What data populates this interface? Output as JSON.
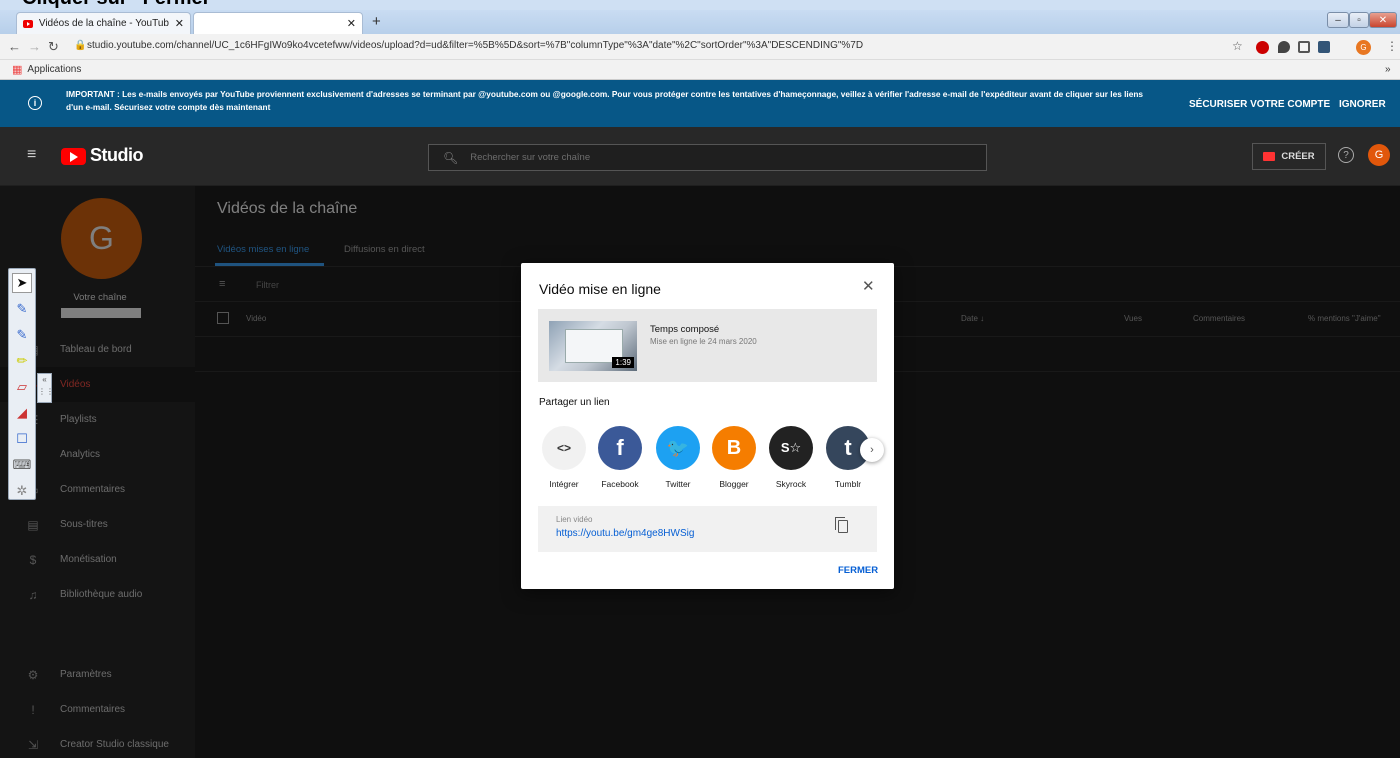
{
  "caption": "Cliquer sur \"Fermer\"",
  "browser": {
    "tab_title": "Vidéos de la chaîne - YouTube S",
    "tab_close": "✕",
    "new_tab": "+",
    "url": "studio.youtube.com/channel/UC_1c6HFgIWo9ko4vcetefww/videos/upload?d=ud&filter=%5B%5D&sort=%7B\"columnType\"%3A\"date\"%2C\"sortOrder\"%3A\"DESCENDING\"%7D",
    "bookmarks_label": "Applications",
    "bookmarks_more": "»",
    "profile_initial": "G"
  },
  "banner": {
    "text": "IMPORTANT : Les e-mails envoyés par YouTube proviennent exclusivement d'adresses se terminant par @youtube.com ou @google.com. Pour vous protéger contre les tentatives d'hameçonnage, veillez à vérifier l'adresse e-mail de l'expéditeur avant de cliquer sur les liens d'un e-mail. Sécurisez votre compte dès maintenant",
    "secure_label": "SÉCURISER VOTRE COMPTE",
    "ignore_label": "IGNORER"
  },
  "header": {
    "logo_text": "Studio",
    "search_placeholder": "Rechercher sur votre chaîne",
    "create_label": "CRÉER",
    "avatar_initial": "G"
  },
  "sidebar": {
    "avatar_initial": "G",
    "channel_label": "Votre chaîne",
    "items": [
      {
        "label": "Tableau de bord"
      },
      {
        "label": "Vidéos"
      },
      {
        "label": "Playlists"
      },
      {
        "label": "Analytics"
      },
      {
        "label": "Commentaires"
      },
      {
        "label": "Sous-titres"
      },
      {
        "label": "Monétisation"
      },
      {
        "label": "Bibliothèque audio"
      },
      {
        "label": "Paramètres"
      },
      {
        "label": "Commentaires"
      },
      {
        "label": "Creator Studio classique"
      }
    ]
  },
  "main": {
    "title": "Vidéos de la chaîne",
    "tabs": [
      {
        "label": "Vidéos mises en ligne"
      },
      {
        "label": "Diffusions en direct"
      }
    ],
    "filter_placeholder": "Filtrer",
    "columns": [
      "Vidéo",
      "Date ↓",
      "Vues",
      "Commentaires",
      "% mentions \"J'aime\""
    ]
  },
  "dialog": {
    "title": "Vidéo mise en ligne",
    "video_title": "Temps composé",
    "video_subtitle": "Mise en ligne le 24 mars 2020",
    "duration": "1:39",
    "share_heading": "Partager un lien",
    "share": [
      {
        "label": "Intégrer",
        "glyph": "<>",
        "color": "#f1f1f1"
      },
      {
        "label": "Facebook",
        "glyph": "f",
        "color": "#3b5998"
      },
      {
        "label": "Twitter",
        "glyph": "🐦",
        "color": "#1da1f2"
      },
      {
        "label": "Blogger",
        "glyph": "B",
        "color": "#f57d00"
      },
      {
        "label": "Skyrock",
        "glyph": "S☆",
        "color": "#222222"
      },
      {
        "label": "Tumblr",
        "glyph": "t",
        "color": "#35465c"
      }
    ],
    "link_label": "Lien vidéo",
    "link_url": "https://youtu.be/gm4ge8HWSig",
    "close_label": "FERMER"
  }
}
